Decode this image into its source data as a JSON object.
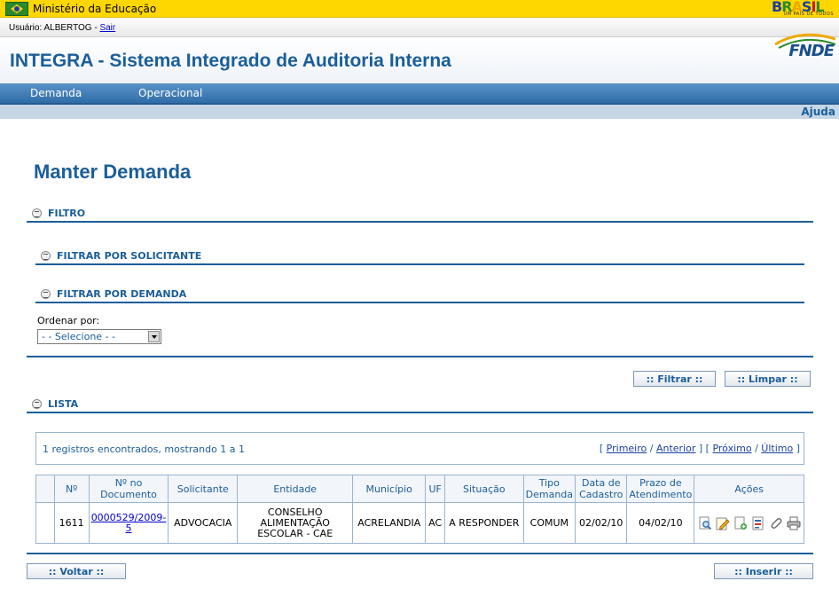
{
  "gov": {
    "title": "Ministério da Educação",
    "brasil": "BRASIL",
    "brasil_sub": "UM PAÍS DE TODOS"
  },
  "user": {
    "label": "Usuário: ALBERTOG - ",
    "logout": "Sair"
  },
  "header": {
    "app_title": "INTEGRA - Sistema Integrado de Auditoria Interna",
    "logo": "FNDE"
  },
  "menu": {
    "items": [
      "Demanda",
      "Operacional"
    ],
    "help": "Ajuda"
  },
  "page": {
    "title": "Manter Demanda"
  },
  "sections": {
    "filtro": "FILTRO",
    "por_solicitante": "FILTRAR POR SOLICITANTE",
    "por_demanda": "FILTRAR POR DEMANDA",
    "lista": "LISTA"
  },
  "ordenar": {
    "label": "Ordenar por:",
    "selected": "- - Selecione - -"
  },
  "buttons": {
    "filtrar": ":: Filtrar ::",
    "limpar": ":: Limpar ::",
    "voltar": ":: Voltar ::",
    "inserir": ":: Inserir ::"
  },
  "info": {
    "count_text": "1 registros encontrados, mostrando 1 a 1",
    "pager": {
      "first": "Primeiro",
      "prev": "Anterior",
      "next": "Próximo",
      "last": "Último"
    }
  },
  "table": {
    "headers": [
      "",
      "Nº",
      "Nº no Documento",
      "Solicitante",
      "Entidade",
      "Município",
      "UF",
      "Situação",
      "Tipo Demanda",
      "Data de Cadastro",
      "Prazo de Atendimento",
      "Ações"
    ],
    "rows": [
      {
        "numero": "1611",
        "documento": "0000529/2009-5",
        "solicitante": "ADVOCACIA",
        "entidade": "CONSELHO ALIMENTAÇÃO ESCOLAR - CAE",
        "municipio": "ACRELANDIA",
        "uf": "AC",
        "situacao": "A RESPONDER",
        "tipo": "COMUM",
        "data_cadastro": "02/02/10",
        "prazo": "04/02/10"
      }
    ],
    "action_icons": [
      "view-icon",
      "edit-icon",
      "add-document-icon",
      "report-icon",
      "attach-icon",
      "print-icon"
    ]
  }
}
